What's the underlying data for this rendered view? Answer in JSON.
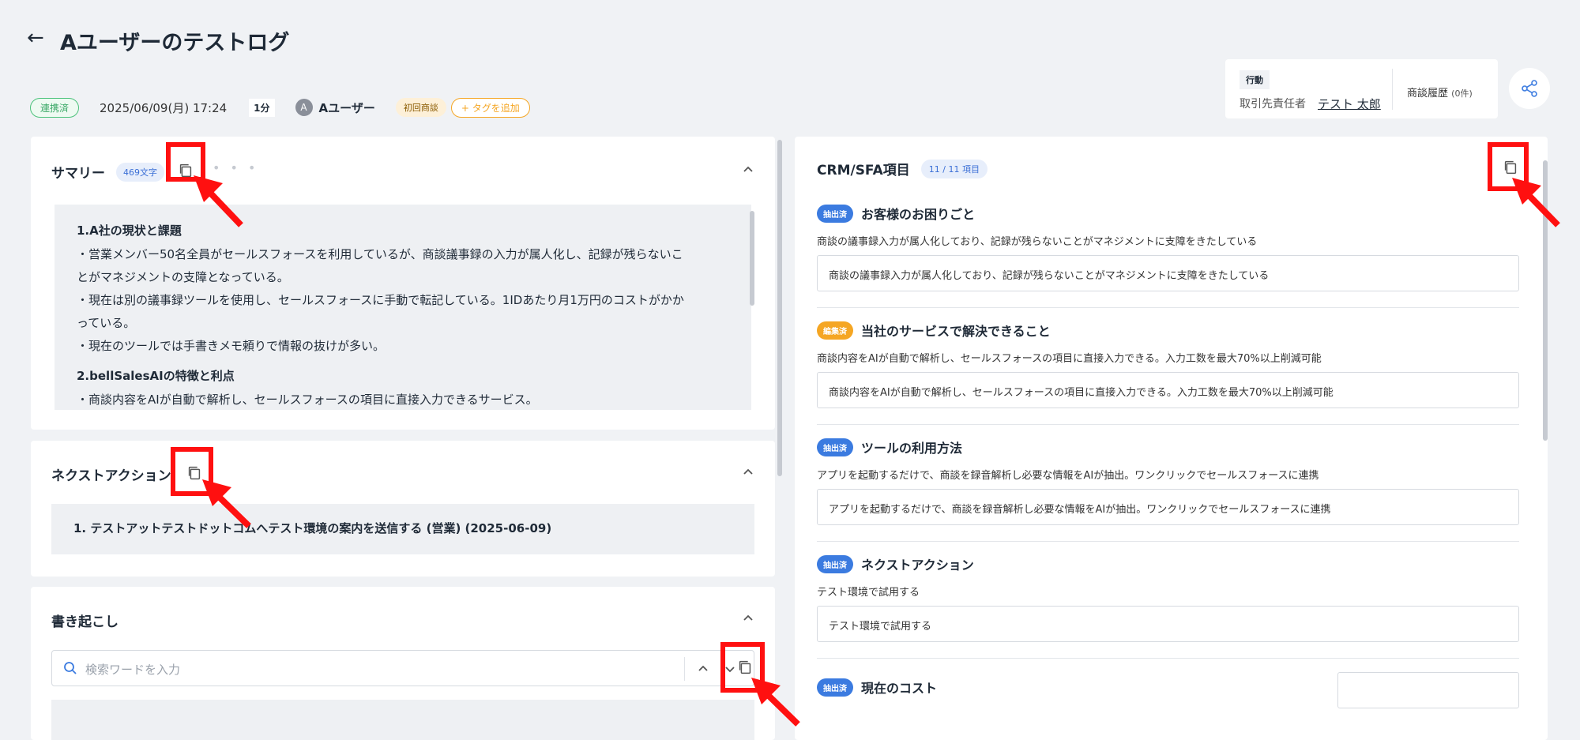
{
  "header": {
    "title": "Aユーザーのテストログ",
    "status_badge": "連携済",
    "datetime": "2025/06/09(月) 17:24",
    "duration": "1分",
    "avatar_initial": "A",
    "user": "Aユーザー",
    "tag": "初回商談",
    "add_tag": "+ タグを追加"
  },
  "action_box": {
    "title": "行動",
    "label": "取引先責任者",
    "link": "テスト 太郎",
    "history": "商談履歴",
    "history_count": "(0件)"
  },
  "summary": {
    "title": "サマリー",
    "char_count": "469文字",
    "sections": [
      {
        "heading": "1.A社の現状と課題",
        "lines": [
          "・営業メンバー50名全員がセールスフォースを利用しているが、商談議事録の入力が属人化し、記録が残らないこ",
          "とがマネジメントの支障となっている。",
          "・現在は別の議事録ツールを使用し、セールスフォースに手動で転記している。1IDあたり月1万円のコストがかか",
          "っている。",
          "・現在のツールでは手書きメモ頼りで情報の抜けが多い。"
        ]
      },
      {
        "heading": "2.bellSalesAIの特徴と利点",
        "lines": [
          "・商談内容をAIが自動で解析し、セールスフォースの項目に直接入力できるサービス。"
        ]
      }
    ]
  },
  "next_action": {
    "title": "ネクストアクション",
    "item": "1. テストアットテストドットコムへテスト環境の案内を送信する (営業) (2025-06-09)"
  },
  "transcript": {
    "title": "書き起こし",
    "search_placeholder": "検索ワードを入力"
  },
  "crm": {
    "title": "CRM/SFA項目",
    "count": "11 / 11 項目",
    "items": [
      {
        "badge": "抽出済",
        "badge_color": "#3b7be0",
        "label": "お客様のお困りごと",
        "summary": "商談の議事録入力が属人化しており、記録が残らないことがマネジメントに支障をきたしている",
        "value": "商談の議事録入力が属人化しており、記録が残らないことがマネジメントに支障をきたしている"
      },
      {
        "badge": "編集済",
        "badge_color": "#f5a623",
        "label": "当社のサービスで解決できること",
        "summary": "商談内容をAIが自動で解析し、セールスフォースの項目に直接入力できる。入力工数を最大70%以上削減可能",
        "value": "商談内容をAIが自動で解析し、セールスフォースの項目に直接入力できる。入力工数を最大70%以上削減可能"
      },
      {
        "badge": "抽出済",
        "badge_color": "#3b7be0",
        "label": "ツールの利用方法",
        "summary": "アプリを起動するだけで、商談を録音解析し必要な情報をAIが抽出。ワンクリックでセールスフォースに連携",
        "value": "アプリを起動するだけで、商談を録音解析し必要な情報をAIが抽出。ワンクリックでセールスフォースに連携"
      },
      {
        "badge": "抽出済",
        "badge_color": "#3b7be0",
        "label": "ネクストアクション",
        "summary": "テスト環境で試用する",
        "value": "テスト環境で試用する"
      },
      {
        "badge": "抽出済",
        "badge_color": "#3b7be0",
        "label": "現在のコスト",
        "summary": "",
        "value": ""
      }
    ]
  },
  "colors": {
    "accent": "#3b7be0",
    "annotation": "#ff1010",
    "linked_green": "#3aa866",
    "tag_orange": "#f5a623"
  }
}
